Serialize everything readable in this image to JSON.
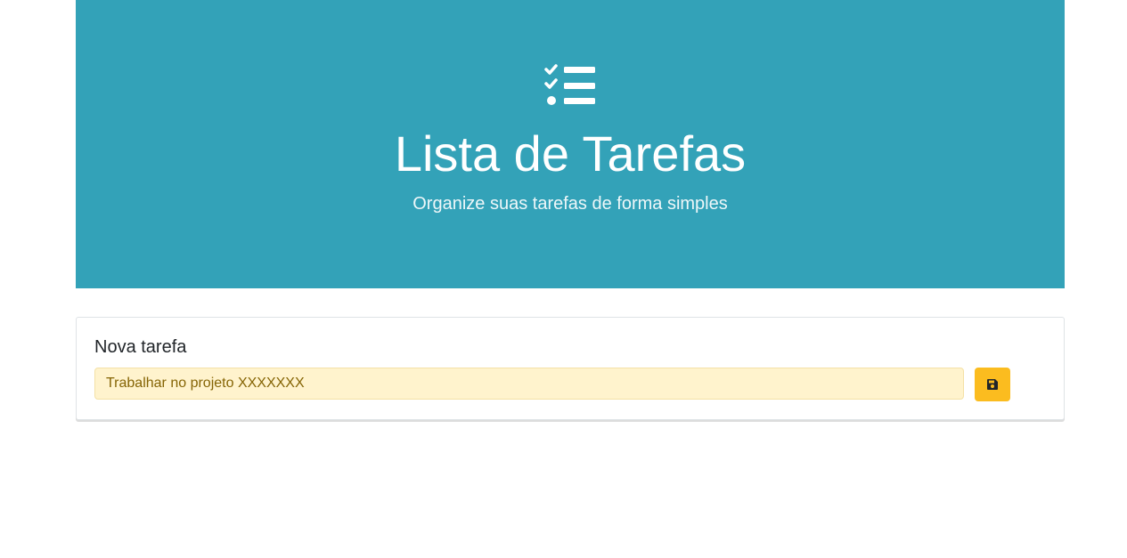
{
  "hero": {
    "icon": "tasks-list-icon",
    "title": "Lista de Tarefas",
    "subtitle": "Organize suas tarefas de forma simples",
    "background_color": "#33a2b8"
  },
  "new_task": {
    "title": "Nova tarefa",
    "input_value": "Trabalhar no projeto XXXXXXX",
    "save_icon": "save-icon",
    "input_background": "#fff3cd",
    "button_color": "#fbbc1f"
  }
}
